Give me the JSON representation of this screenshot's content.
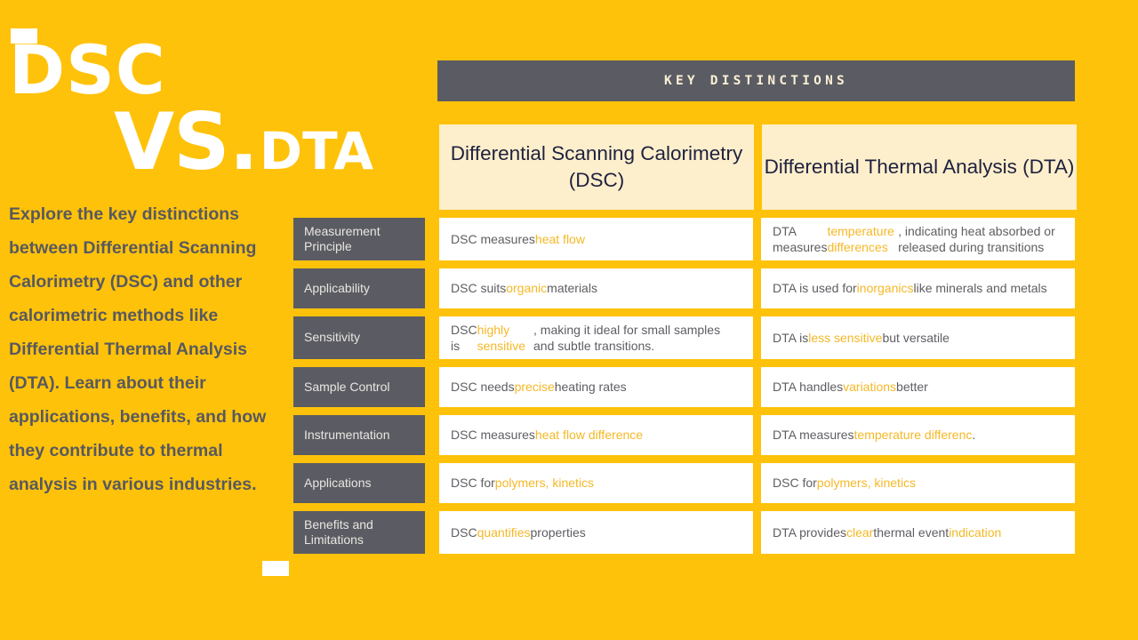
{
  "title": {
    "line1": "DSC",
    "vs": "VS.",
    "line2": "DTA"
  },
  "intro": "Explore the key distinctions between Differential Scanning Calorimetry (DSC) and other calorimetric methods like Differential Thermal Analysis (DTA). Learn about their applications, benefits, and how they contribute to thermal analysis in various industries.",
  "banner": {
    "label": "KEY DISTINCTIONS"
  },
  "columns": [
    {
      "title": "Differential Scanning Calorimetry (DSC)"
    },
    {
      "title": "Differential Thermal Analysis (DTA)"
    }
  ],
  "rows": [
    {
      "label": "Measurement Principle",
      "dsc": [
        {
          "t": "DSC measures ",
          "hl": false
        },
        {
          "t": "heat flow",
          "hl": true
        }
      ],
      "dta": [
        {
          "t": "DTA measures ",
          "hl": false
        },
        {
          "t": "temperature differences",
          "hl": true
        },
        {
          "t": ", indicating heat absorbed or released during transitions",
          "hl": false
        }
      ]
    },
    {
      "label": "Applicability",
      "dsc": [
        {
          "t": "DSC suits ",
          "hl": false
        },
        {
          "t": "organic",
          "hl": true
        },
        {
          "t": " materials",
          "hl": false
        }
      ],
      "dta": [
        {
          "t": "DTA is used for ",
          "hl": false
        },
        {
          "t": "inorganics",
          "hl": true
        },
        {
          "t": " like minerals and metals",
          "hl": false
        }
      ]
    },
    {
      "label": "Sensitivity",
      "dsc": [
        {
          "t": "DSC is ",
          "hl": false
        },
        {
          "t": "highly sensitive",
          "hl": true
        },
        {
          "t": ", making it ideal for small samples and subtle transitions.",
          "hl": false
        }
      ],
      "dta": [
        {
          "t": "DTA is ",
          "hl": false
        },
        {
          "t": "less sensitive",
          "hl": true
        },
        {
          "t": " but versatile",
          "hl": false
        }
      ]
    },
    {
      "label": "Sample Control",
      "dsc": [
        {
          "t": "DSC needs ",
          "hl": false
        },
        {
          "t": "precise",
          "hl": true
        },
        {
          "t": " heating rates",
          "hl": false
        }
      ],
      "dta": [
        {
          "t": "DTA handles ",
          "hl": false
        },
        {
          "t": "variations",
          "hl": true
        },
        {
          "t": " better",
          "hl": false
        }
      ]
    },
    {
      "label": "Instrumentation",
      "dsc": [
        {
          "t": "DSC measures ",
          "hl": false
        },
        {
          "t": "heat flow difference",
          "hl": true
        }
      ],
      "dta": [
        {
          "t": "DTA measures ",
          "hl": false
        },
        {
          "t": "temperature differenc",
          "hl": true
        },
        {
          "t": ".",
          "hl": false
        }
      ]
    },
    {
      "label": "Applications",
      "dsc": [
        {
          "t": "DSC for ",
          "hl": false
        },
        {
          "t": "polymers, kinetics",
          "hl": true
        }
      ],
      "dta": [
        {
          "t": "DSC for ",
          "hl": false
        },
        {
          "t": "polymers, kinetics",
          "hl": true
        }
      ]
    },
    {
      "label": "Benefits and Limitations",
      "dsc": [
        {
          "t": "DSC ",
          "hl": false
        },
        {
          "t": "quantifies",
          "hl": true
        },
        {
          "t": " properties",
          "hl": false
        }
      ],
      "dta": [
        {
          "t": "DTA provides ",
          "hl": false
        },
        {
          "t": "clear",
          "hl": true
        },
        {
          "t": " thermal event ",
          "hl": false
        },
        {
          "t": "indication",
          "hl": true
        }
      ]
    }
  ],
  "colors": {
    "background": "#FFC20A",
    "dark_gray": "#5B5C63",
    "cream": "#FDEFCB",
    "highlight": "#F5B826",
    "white": "#FFFFFF",
    "navy": "#1F2140"
  }
}
